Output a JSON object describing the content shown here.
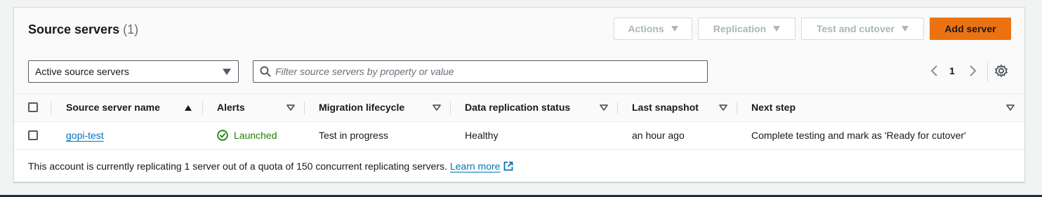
{
  "panel": {
    "title": "Source servers",
    "count": "(1)",
    "buttons": {
      "actions": "Actions",
      "replication": "Replication",
      "test_cutover": "Test and cutover",
      "add_server": "Add server"
    },
    "filter_select": "Active source servers",
    "search_placeholder": "Filter source servers by property or value",
    "pagination": {
      "current_page": "1"
    },
    "colors": {
      "accent": "#ec7211",
      "link": "#0073bb",
      "success": "#1d8102"
    }
  },
  "table": {
    "columns": {
      "name": "Source server name",
      "alerts": "Alerts",
      "lifecycle": "Migration lifecycle",
      "replication_status": "Data replication status",
      "last_snapshot": "Last snapshot",
      "next_step": "Next step"
    },
    "rows": [
      {
        "name": "gopi-test",
        "alert": "Launched",
        "lifecycle": "Test in progress",
        "replication_status": "Healthy",
        "last_snapshot": "an hour ago",
        "next_step": "Complete testing and mark as 'Ready for cutover'"
      }
    ]
  },
  "footer": {
    "note": "This account is currently replicating 1 server out of a quota of 150 concurrent replicating servers.",
    "learn_more": "Learn more"
  }
}
